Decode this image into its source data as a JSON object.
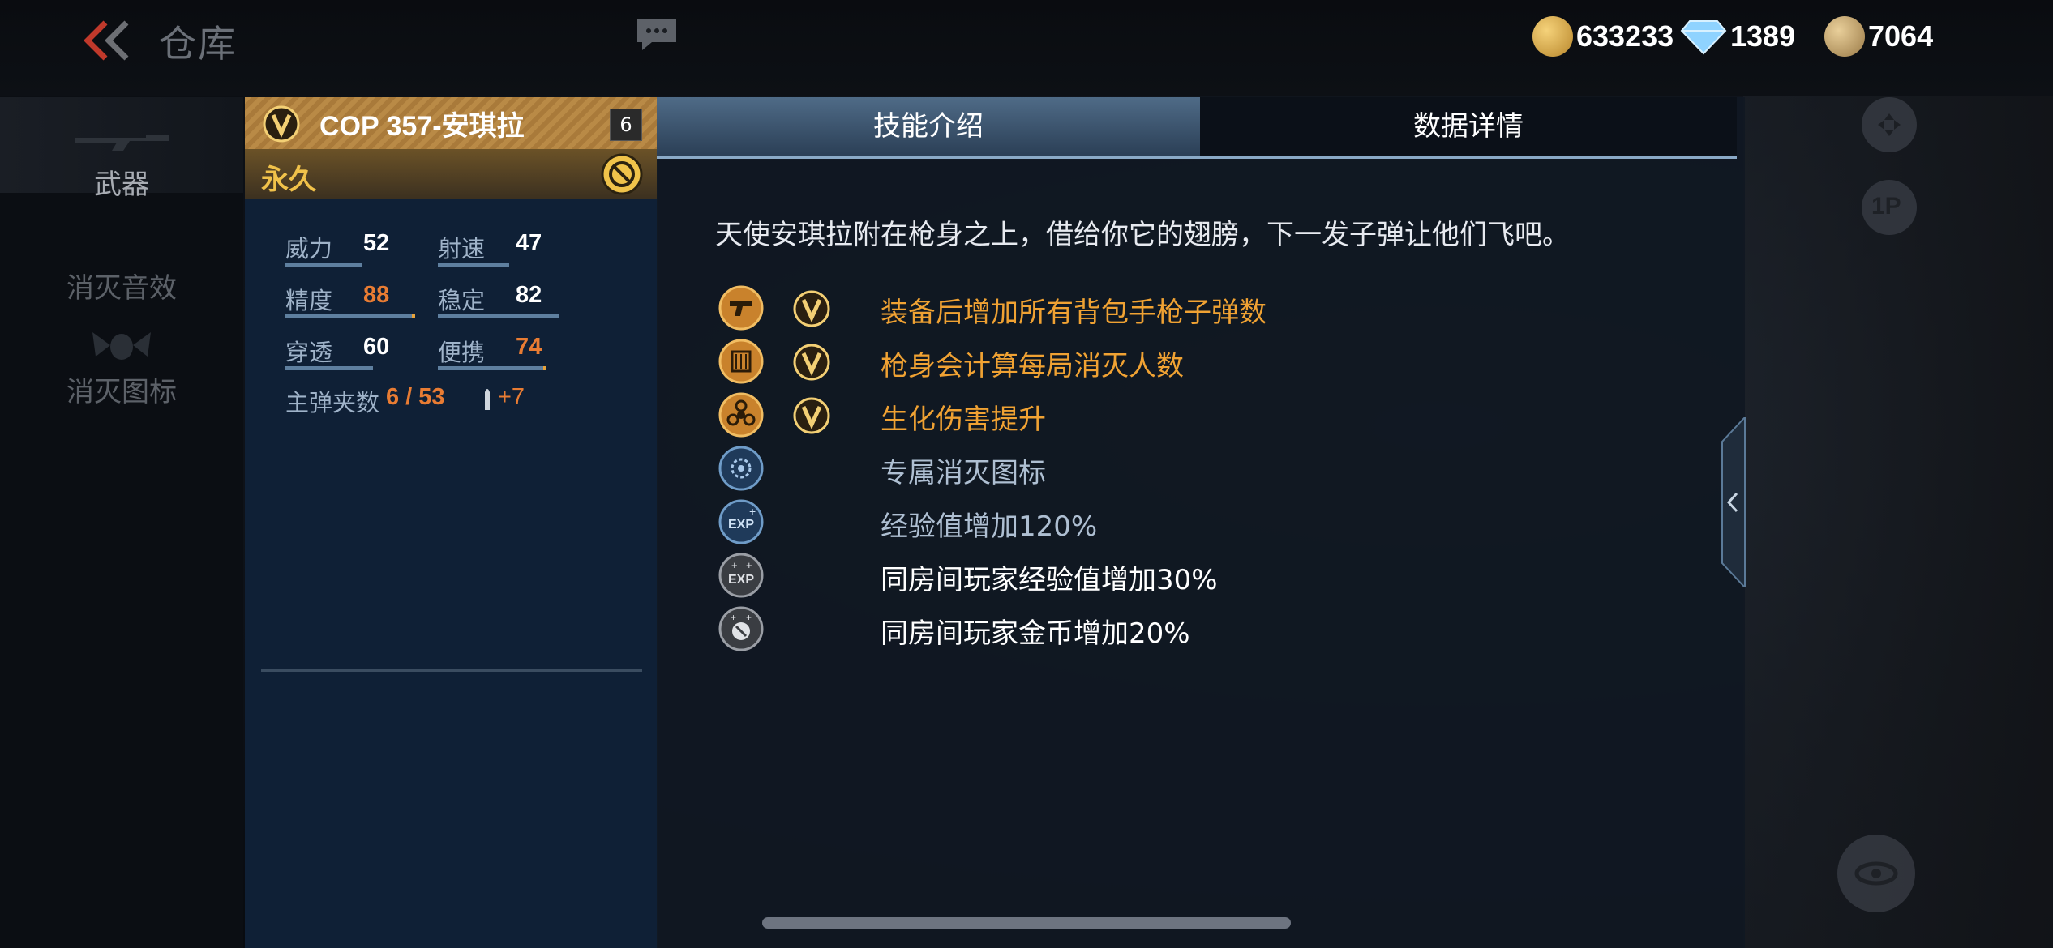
{
  "header": {
    "title": "仓库",
    "currencies": [
      {
        "icon": "gold-coin-icon",
        "value": "633233"
      },
      {
        "icon": "diamond-icon",
        "value": "1389"
      },
      {
        "icon": "medal-coin-icon",
        "value": "7064"
      }
    ]
  },
  "nav": {
    "items": [
      {
        "label": "武器",
        "active": true
      },
      {
        "label": "消灭音效",
        "active": false
      },
      {
        "label": "消灭图标",
        "active": false
      }
    ]
  },
  "weapon": {
    "name": "COP 357-安琪拉",
    "level": "6",
    "duration": "永久",
    "stats": [
      {
        "label": "威力",
        "value": "52",
        "pct": 0.52,
        "highlight": false
      },
      {
        "label": "射速",
        "value": "47",
        "pct": 0.47,
        "highlight": false
      },
      {
        "label": "精度",
        "value": "88",
        "pct": 0.88,
        "highlight": true
      },
      {
        "label": "稳定",
        "value": "82",
        "pct": 0.82,
        "highlight": false
      },
      {
        "label": "穿透",
        "value": "60",
        "pct": 0.6,
        "highlight": false
      },
      {
        "label": "便携",
        "value": "74",
        "pct": 0.74,
        "highlight": true
      }
    ],
    "ammo_label": "主弹夹数",
    "ammo_value": "6 / 53",
    "ammo_bonus": "+7"
  },
  "panel": {
    "tabs": [
      {
        "label": "技能介绍",
        "active": true
      },
      {
        "label": "数据详情",
        "active": false
      }
    ],
    "description": "天使安琪拉附在枪身之上，借给你它的翅膀，下一发子弹让他们飞吧。",
    "skills": [
      {
        "icon": "pistol-icon",
        "vip": true,
        "text": "装备后增加所有背包手枪子弹数",
        "color": "#f0a233"
      },
      {
        "icon": "counter-icon",
        "vip": true,
        "text": "枪身会计算每局消灭人数",
        "color": "#f0a233"
      },
      {
        "icon": "biohazard-icon",
        "vip": true,
        "text": "生化伤害提升",
        "color": "#f0a233"
      },
      {
        "icon": "kill-icon-badge",
        "vip": false,
        "text": "专属消灭图标",
        "color": "#aebfd2"
      },
      {
        "icon": "exp-icon",
        "vip": false,
        "text": "经验值增加120%",
        "color": "#aebfd2"
      },
      {
        "icon": "team-exp-icon",
        "vip": false,
        "text": "同房间玩家经验值增加30%",
        "color": "#ffffff"
      },
      {
        "icon": "team-gold-icon",
        "vip": false,
        "text": "同房间玩家金币增加20%",
        "color": "#ffffff"
      }
    ]
  },
  "colors": {
    "gold": "#f0a233",
    "accent_blue": "#8aa9c6",
    "stat_high": "#e87c33"
  }
}
